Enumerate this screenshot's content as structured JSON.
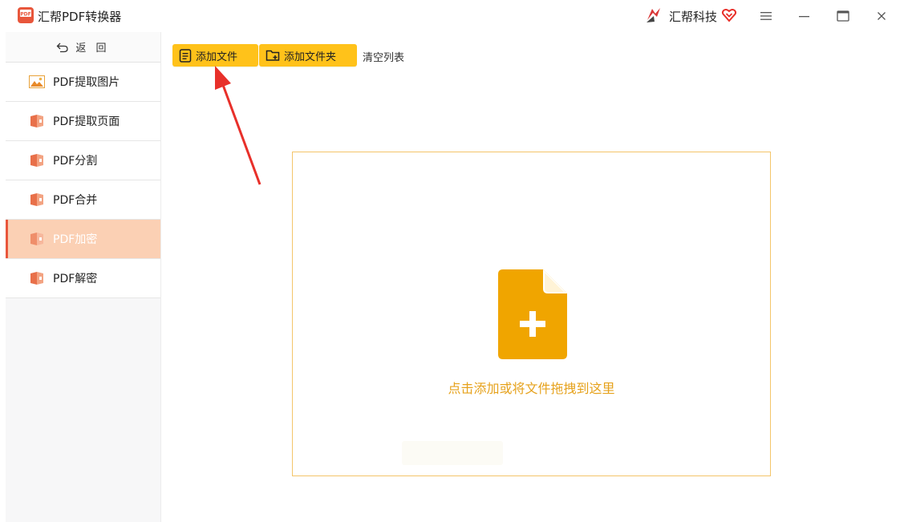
{
  "app": {
    "logo_text": "PDF",
    "title": "汇帮PDF转换器",
    "brand_name": "汇帮科技"
  },
  "sidebar": {
    "back_label": "返 回",
    "items": [
      {
        "label": "PDF提取图片",
        "icon": "image-icon",
        "active": false
      },
      {
        "label": "PDF提取页面",
        "icon": "book-icon",
        "active": false
      },
      {
        "label": "PDF分割",
        "icon": "book-icon",
        "active": false
      },
      {
        "label": "PDF合并",
        "icon": "book-icon",
        "active": false
      },
      {
        "label": "PDF加密",
        "icon": "book-icon",
        "active": true
      },
      {
        "label": "PDF解密",
        "icon": "book-icon",
        "active": false
      }
    ]
  },
  "toolbar": {
    "add_file_label": "添加文件",
    "add_folder_label": "添加文件夹",
    "clear_list_label": "清空列表"
  },
  "drop_zone": {
    "hint": "点击添加或将文件拖拽到这里"
  },
  "colors": {
    "accent": "#ffc21a",
    "active_item_bg": "#fbd0b4",
    "active_indicator": "#e8563b",
    "drop_border": "#f4c56a",
    "hint_text": "#e6a21c",
    "file_icon": "#f0a500",
    "annotation_arrow": "#e8302a"
  }
}
